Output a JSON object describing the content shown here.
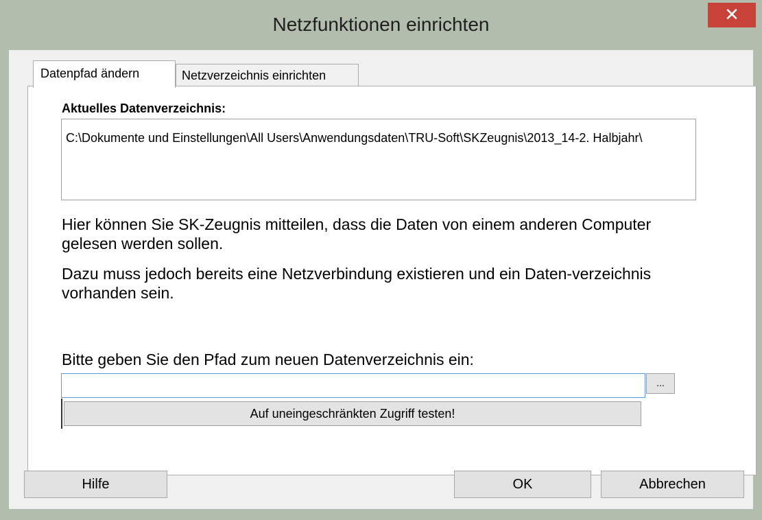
{
  "window": {
    "title": "Netzfunktionen einrichten",
    "close_glyph": "✕"
  },
  "tabs": [
    {
      "label": "Datenpfad ändern",
      "active": true
    },
    {
      "label": "Netzverzeichnis einrichten",
      "active": false
    }
  ],
  "current_dir": {
    "label": "Aktuelles Datenverzeichnis:",
    "path": "C:\\Dokumente und Einstellungen\\All Users\\Anwendungsdaten\\TRU-Soft\\SKZeugnis\\2013_14-2. Halbjahr\\"
  },
  "info": {
    "line1": "Hier können Sie SK-Zeugnis mitteilen, dass die Daten von einem anderen Computer gelesen werden sollen.",
    "line2": "Dazu muss jedoch bereits eine Netzverbindung existieren und ein Daten-verzeichnis vorhanden sein."
  },
  "new_path": {
    "label": "Bitte geben Sie den Pfad zum neuen Datenverzeichnis ein:",
    "value": "",
    "browse_label": "...",
    "test_label": "Auf uneingeschränkten Zugriff testen!"
  },
  "buttons": {
    "help": "Hilfe",
    "ok": "OK",
    "cancel": "Abbrechen"
  }
}
